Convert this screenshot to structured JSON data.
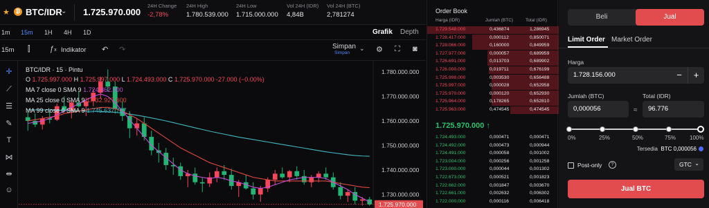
{
  "ticker": {
    "pair": "BTC/IDR",
    "coin_symbol": "₿",
    "last_price": "1.725.970.000",
    "stats": [
      {
        "label": "24H Change",
        "value": "-2,78%",
        "negative": true
      },
      {
        "label": "24H High",
        "value": "1.780.539.000",
        "negative": false
      },
      {
        "label": "24H Low",
        "value": "1.715.000.000",
        "negative": false
      },
      {
        "label": "Vol 24H (IDR)",
        "value": "4,84B",
        "negative": false
      },
      {
        "label": "Vol 24H (BTC)",
        "value": "2,781274",
        "negative": false
      }
    ]
  },
  "timeframes": [
    "1m",
    "15m",
    "1H",
    "4H",
    "1D"
  ],
  "active_timeframe": "15m",
  "view_tabs": {
    "grafik": "Grafik",
    "depth": "Depth",
    "active": "Grafik"
  },
  "chart_toolbar": {
    "interval": "15m",
    "indikator": "Indikator",
    "simpan": "Simpan",
    "simpan_sub": "Simpan"
  },
  "legend": {
    "title": "BTC/IDR · 15 · Pintu",
    "ohlc": {
      "o": "1.725.997.000",
      "h": "1.725.997.000",
      "l": "1.724.493.000",
      "c": "1.725.970.000",
      "change": "-27.000 (−0.00%)"
    },
    "ma": [
      {
        "label": "MA 7 close 0 SMA 9",
        "value": "1.724.862.000",
        "color": "#c44bd8"
      },
      {
        "label": "MA 25 close 0 SMA 9",
        "value": "1.732.927.600",
        "color": "#e4473d"
      },
      {
        "label": "MA 99 close 0 SMA 9",
        "value": "1.745.637.767",
        "color": "#3fb8c4"
      }
    ]
  },
  "chart_data": {
    "type": "candlestick",
    "price_axis": [
      "1.780.000.000",
      "1.770.000.000",
      "1.760.000.000",
      "1.750.000.000",
      "1.740.000.000",
      "1.730.000.000"
    ],
    "ylim": [
      1724500000,
      1784500000
    ],
    "current_price_label": "1.725.970.000",
    "colors": {
      "up": "#f5475a",
      "down": "#22b573",
      "ma7": "#c44bd8",
      "ma25": "#e4473d",
      "ma99": "#3fb8c4"
    },
    "candles": [
      [
        1761.5,
        1763.5,
        1756.0,
        1760.0
      ],
      [
        1760.0,
        1763.0,
        1757.5,
        1758.5
      ],
      [
        1758.5,
        1762.0,
        1756.5,
        1761.0
      ],
      [
        1761.0,
        1764.0,
        1759.0,
        1760.5
      ],
      [
        1760.5,
        1767.0,
        1760.0,
        1766.0
      ],
      [
        1766.0,
        1770.0,
        1763.5,
        1764.0
      ],
      [
        1764.0,
        1768.5,
        1761.0,
        1767.5
      ],
      [
        1767.5,
        1772.0,
        1765.5,
        1766.0
      ],
      [
        1766.0,
        1769.5,
        1762.0,
        1768.0
      ],
      [
        1768.0,
        1773.0,
        1766.0,
        1771.5
      ],
      [
        1771.5,
        1778.0,
        1769.0,
        1776.0
      ],
      [
        1776.0,
        1781.0,
        1772.0,
        1774.0
      ],
      [
        1774.0,
        1776.0,
        1763.0,
        1765.0
      ],
      [
        1765.0,
        1768.0,
        1760.0,
        1762.0
      ],
      [
        1762.0,
        1764.0,
        1753.0,
        1757.0
      ],
      [
        1757.0,
        1761.0,
        1754.0,
        1759.0
      ],
      [
        1759.0,
        1761.5,
        1752.0,
        1753.5
      ],
      [
        1753.5,
        1756.0,
        1746.0,
        1748.0
      ],
      [
        1748.0,
        1751.0,
        1743.0,
        1747.0
      ],
      [
        1747.0,
        1749.0,
        1740.0,
        1742.0
      ],
      [
        1742.0,
        1745.0,
        1738.0,
        1741.5
      ],
      [
        1741.5,
        1743.0,
        1736.0,
        1737.5
      ],
      [
        1737.5,
        1740.0,
        1733.0,
        1738.5
      ],
      [
        1738.5,
        1741.0,
        1734.0,
        1735.0
      ],
      [
        1735.0,
        1737.0,
        1731.0,
        1734.5
      ],
      [
        1734.5,
        1739.0,
        1733.0,
        1737.0
      ],
      [
        1737.0,
        1741.0,
        1735.0,
        1739.5
      ],
      [
        1739.5,
        1742.0,
        1736.0,
        1738.0
      ],
      [
        1738.0,
        1740.5,
        1732.0,
        1733.5
      ],
      [
        1733.5,
        1736.0,
        1729.0,
        1735.0
      ],
      [
        1735.0,
        1738.0,
        1732.0,
        1732.5
      ],
      [
        1732.5,
        1735.0,
        1728.0,
        1730.0
      ],
      [
        1730.0,
        1733.5,
        1727.0,
        1732.5
      ],
      [
        1732.5,
        1737.0,
        1731.0,
        1736.0
      ],
      [
        1736.0,
        1740.0,
        1734.0,
        1738.5
      ],
      [
        1738.5,
        1741.0,
        1736.5,
        1737.0
      ],
      [
        1737.0,
        1740.0,
        1735.0,
        1739.5
      ],
      [
        1739.5,
        1741.5,
        1736.0,
        1737.5
      ],
      [
        1737.5,
        1740.0,
        1734.0,
        1735.0
      ],
      [
        1735.0,
        1738.0,
        1733.0,
        1737.0
      ],
      [
        1737.0,
        1739.5,
        1735.0,
        1738.5
      ],
      [
        1738.5,
        1741.0,
        1736.0,
        1737.0
      ],
      [
        1737.0,
        1739.0,
        1732.0,
        1733.0
      ],
      [
        1733.0,
        1735.0,
        1728.0,
        1729.5
      ],
      [
        1729.5,
        1732.0,
        1727.0,
        1731.0
      ],
      [
        1731.0,
        1733.0,
        1726.0,
        1727.5
      ],
      [
        1727.5,
        1729.0,
        1725.5,
        1728.0
      ],
      [
        1728.0,
        1729.0,
        1725.5,
        1726.0
      ]
    ],
    "ma7": [
      1759,
      1759.5,
      1760,
      1761,
      1762.5,
      1764,
      1765.5,
      1767,
      1768.5,
      1770,
      1771,
      1770,
      1767.5,
      1764,
      1760.5,
      1757,
      1753.5,
      1750,
      1747.5,
      1745,
      1742.5,
      1740,
      1738.5,
      1737.5,
      1737,
      1736.5,
      1737,
      1736.5,
      1735.5,
      1735,
      1734,
      1733,
      1732.5,
      1733,
      1734,
      1735,
      1736,
      1736.5,
      1737,
      1737,
      1737,
      1736.5,
      1735,
      1733.5,
      1732,
      1730,
      1728.5,
      1727
    ],
    "ma25": [
      1760,
      1760.5,
      1761,
      1761.5,
      1762,
      1763,
      1763.5,
      1764,
      1764.5,
      1765,
      1765.5,
      1765.5,
      1765,
      1764,
      1762.5,
      1761,
      1759,
      1757,
      1755,
      1753,
      1751,
      1749,
      1747.5,
      1746,
      1744.5,
      1743,
      1742,
      1741,
      1740,
      1739,
      1738,
      1737,
      1736.5,
      1736,
      1735.5,
      1735.5,
      1735.5,
      1735.5,
      1735.5,
      1735.5,
      1735.5,
      1735.5,
      1735,
      1734.5,
      1734,
      1733.5,
      1733,
      1732.8
    ],
    "ma99": [
      1764.5,
      1764.5,
      1764.5,
      1764.5,
      1764.4,
      1764.3,
      1764.2,
      1764.1,
      1764,
      1763.9,
      1763.8,
      1763.7,
      1763.5,
      1763.2,
      1762.8,
      1762.3,
      1761.8,
      1761.2,
      1760.6,
      1760,
      1759.3,
      1758.6,
      1757.9,
      1757.2,
      1756.5,
      1755.8,
      1755.2,
      1754.6,
      1754,
      1753.4,
      1752.9,
      1752.4,
      1751.9,
      1751.4,
      1750.9,
      1750.4,
      1749.9,
      1749.4,
      1748.9,
      1748.4,
      1747.9,
      1747.4,
      1747,
      1746.6,
      1746.2,
      1745.9,
      1745.7,
      1745.6
    ]
  },
  "orderbook": {
    "title": "Order Book",
    "headers": [
      "Harga (IDR)",
      "Jumlah (BTC)",
      "Total (IDR)"
    ],
    "asks": [
      {
        "price": "1.729.548.000",
        "qty": "0,436874",
        "total": "1,286945",
        "depth": 1.0
      },
      {
        "price": "1.728.417.000",
        "qty": "0,000112",
        "total": "0,850071",
        "depth": 0.66
      },
      {
        "price": "1.728.066.000",
        "qty": "0,160000",
        "total": "0,849959",
        "depth": 0.66
      },
      {
        "price": "1.727.977.000",
        "qty": "0,000057",
        "total": "0,689959",
        "depth": 0.54
      },
      {
        "price": "1.726.691.000",
        "qty": "0,013703",
        "total": "0,689902",
        "depth": 0.54
      },
      {
        "price": "1.726.000.000",
        "qty": "0,019711",
        "total": "0,676199",
        "depth": 0.53
      },
      {
        "price": "1.725.998.000",
        "qty": "0,003530",
        "total": "0,656488",
        "depth": 0.51
      },
      {
        "price": "1.725.997.000",
        "qty": "0,000028",
        "total": "0,652958",
        "depth": 0.51
      },
      {
        "price": "1.725.970.000",
        "qty": "0,000120",
        "total": "0,652930",
        "depth": 0.51
      },
      {
        "price": "1.725.964.000",
        "qty": "0,178265",
        "total": "0,652810",
        "depth": 0.51
      },
      {
        "price": "1.725.963.000",
        "qty": "0,474545",
        "total": "0,474545",
        "depth": 0.37
      }
    ],
    "last_price": "1.725.970.000",
    "last_arrow": "↑",
    "bids": [
      {
        "price": "1.724.493.000",
        "qty": "0,000471",
        "total": "0,000471"
      },
      {
        "price": "1.724.492.000",
        "qty": "0,000473",
        "total": "0,000944"
      },
      {
        "price": "1.724.491.000",
        "qty": "0,000058",
        "total": "0,001002"
      },
      {
        "price": "1.723.004.000",
        "qty": "0,000256",
        "total": "0,001258"
      },
      {
        "price": "1.723.000.000",
        "qty": "0,000044",
        "total": "0,001302"
      },
      {
        "price": "1.722.673.000",
        "qty": "0,000521",
        "total": "0,001823"
      },
      {
        "price": "1.722.662.000",
        "qty": "0,001847",
        "total": "0,003670"
      },
      {
        "price": "1.722.661.000",
        "qty": "0,002632",
        "total": "0,006302"
      },
      {
        "price": "1.722.000.000",
        "qty": "0,000116",
        "total": "0,006418"
      }
    ]
  },
  "trade": {
    "side_buy": "Beli",
    "side_sell": "Jual",
    "order_types": [
      "Limit Order",
      "Market Order"
    ],
    "price_label": "Harga",
    "price_value": "1.728.156.000",
    "amount_label": "Jumlah (BTC)",
    "amount_value": "0,000056",
    "total_label": "Total (IDR)",
    "total_value": "96.776",
    "approx_symbol": "≈",
    "percents": [
      "0%",
      "25%",
      "50%",
      "75%",
      "100%"
    ],
    "available_label": "Tersedia",
    "available_value": "BTC 0,000056",
    "post_only": "Post-only",
    "tif": "GTC",
    "submit": "Jual BTC"
  }
}
